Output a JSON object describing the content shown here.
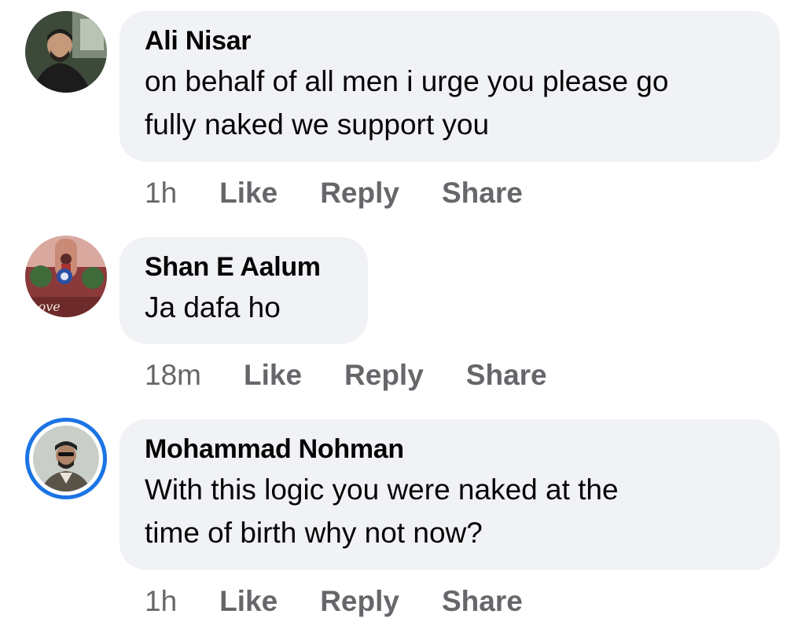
{
  "comments": [
    {
      "author": "Ali Nisar",
      "text_lines": [
        "on behalf of all men i urge you please go",
        "fully naked we support you"
      ],
      "time": "1h",
      "like": "Like",
      "reply": "Reply",
      "share": "Share"
    },
    {
      "author": "Shan E Aalum",
      "text_lines": [
        "Ja dafa ho"
      ],
      "time": "18m",
      "like": "Like",
      "reply": "Reply",
      "share": "Share",
      "avatar_caption": "Love"
    },
    {
      "author": "Mohammad Nohman",
      "text_lines": [
        "With this logic you were naked at the",
        "time of birth why not now?"
      ],
      "time": "1h",
      "like": "Like",
      "reply": "Reply",
      "share": "Share"
    }
  ],
  "colors": {
    "bubble_bg": "#f0f2f5",
    "meta_text": "#65676b",
    "story_ring": "#1b74e4"
  }
}
